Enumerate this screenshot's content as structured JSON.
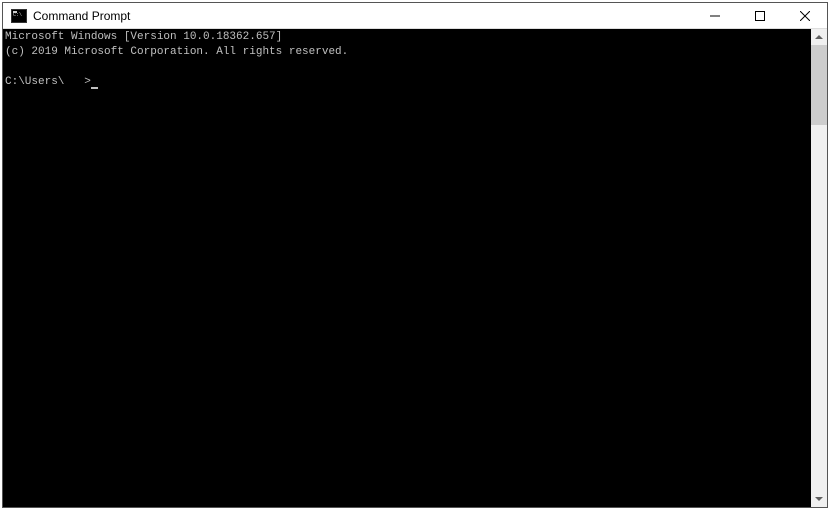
{
  "window": {
    "title": "Command Prompt"
  },
  "terminal": {
    "line1": "Microsoft Windows [Version 10.0.18362.657]",
    "line2": "(c) 2019 Microsoft Corporation. All rights reserved.",
    "prompt": "C:\\Users\\   >",
    "input": ""
  }
}
